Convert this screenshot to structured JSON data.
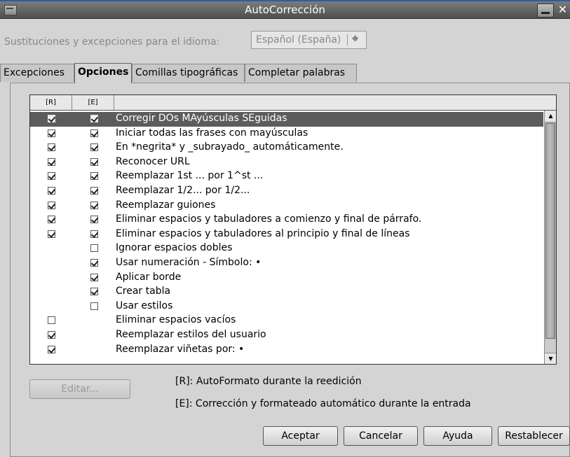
{
  "window": {
    "title": "AutoCorrección"
  },
  "language": {
    "label": "Sustituciones y excepciones para el idioma:",
    "value": "Español (España)"
  },
  "tabs": [
    {
      "label": "Excepciones",
      "active": false
    },
    {
      "label": "Opciones",
      "active": true
    },
    {
      "label": "Comillas tipográficas",
      "active": false
    },
    {
      "label": "Completar palabras",
      "active": false
    }
  ],
  "list": {
    "headers": [
      "[R]",
      "[E]",
      ""
    ],
    "rows": [
      {
        "r": true,
        "e": true,
        "label": "Corregir DOs MAyúsculas SEguidas",
        "selected": true
      },
      {
        "r": true,
        "e": true,
        "label": "Iniciar todas las frases con mayúsculas"
      },
      {
        "r": true,
        "e": true,
        "label": "En *negrita* y _subrayado_ automáticamente."
      },
      {
        "r": true,
        "e": true,
        "label": "Reconocer URL"
      },
      {
        "r": true,
        "e": true,
        "label": "Reemplazar 1st ... por 1^st ..."
      },
      {
        "r": true,
        "e": true,
        "label": "Reemplazar 1/2... por 1/2..."
      },
      {
        "r": true,
        "e": true,
        "label": "Reemplazar guiones"
      },
      {
        "r": true,
        "e": true,
        "label": "Eliminar espacios y tabuladores a comienzo y final de párrafo."
      },
      {
        "r": true,
        "e": true,
        "label": "Eliminar espacios y tabuladores al principio y final de líneas"
      },
      {
        "r": null,
        "e": false,
        "label": "Ignorar espacios dobles"
      },
      {
        "r": null,
        "e": true,
        "label": "Usar numeración - Símbolo: •"
      },
      {
        "r": null,
        "e": true,
        "label": "Aplicar borde"
      },
      {
        "r": null,
        "e": true,
        "label": "Crear tabla"
      },
      {
        "r": null,
        "e": false,
        "label": "Usar estilos"
      },
      {
        "r": false,
        "e": null,
        "label": "Eliminar espacios vacíos"
      },
      {
        "r": true,
        "e": null,
        "label": "Reemplazar estilos del usuario"
      },
      {
        "r": true,
        "e": null,
        "label": "Reemplazar viñetas por: •"
      }
    ]
  },
  "buttons": {
    "edit": "Editar...",
    "accept": "Aceptar",
    "cancel": "Cancelar",
    "help": "Ayuda",
    "reset": "Restablecer"
  },
  "legend": {
    "r": "[R]: AutoFormato durante la reedición",
    "e": "[E]: Corrección y formateado automático durante la entrada"
  }
}
